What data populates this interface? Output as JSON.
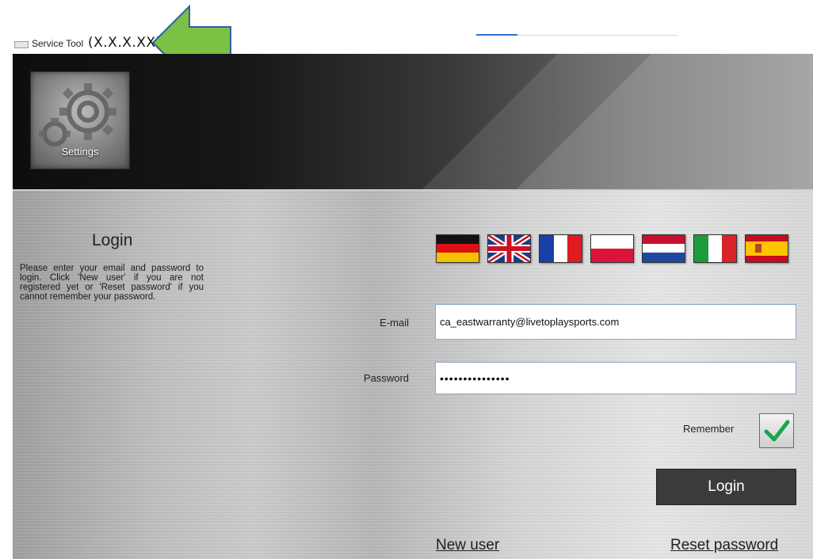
{
  "window": {
    "title": "Service Tool",
    "version": "(X.X.X.XX)",
    "app_icon": "keyboard-icon",
    "arrow_color": "#7cc143"
  },
  "header": {
    "settings_label": "Settings",
    "settings_icon": "gears-icon"
  },
  "login": {
    "title": "Login",
    "help_text": "Please enter your email and password to login. Click 'New user' if you are not registered yet or 'Reset password' if you cannot remember your password.",
    "languages": [
      "German",
      "English",
      "French",
      "Polish",
      "Dutch",
      "Italian",
      "Spanish"
    ],
    "email_label": "E-mail",
    "email_value": "ca_eastwarranty@livetoplaysports.com",
    "password_label": "Password",
    "password_value": "•••••••••••••••",
    "remember_label": "Remember",
    "remember_checked": true,
    "login_button": "Login",
    "new_user_link": "New user",
    "reset_password_link": "Reset password"
  }
}
